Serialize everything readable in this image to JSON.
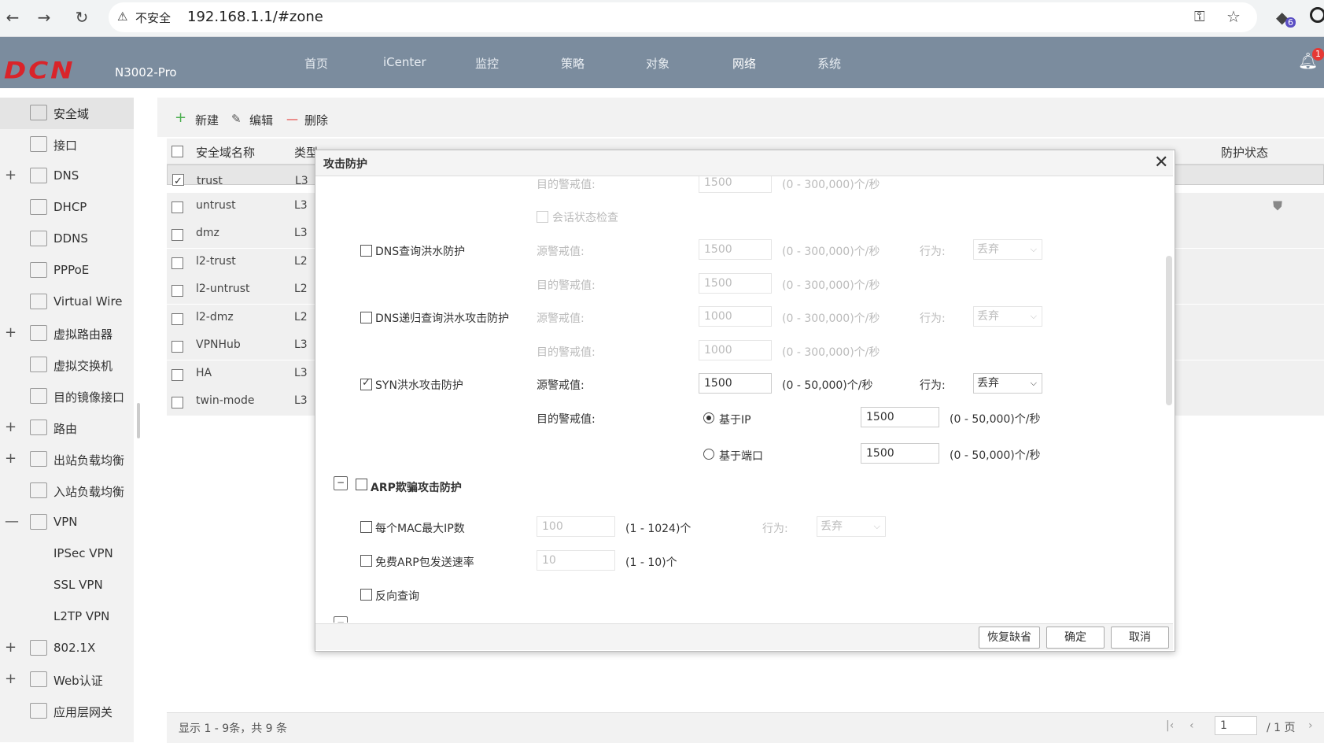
{
  "browser": {
    "back": "←",
    "forward": "→",
    "reload": "↻",
    "security": "不安全",
    "url": "192.168.1.1/#zone",
    "ext_badge": "6"
  },
  "app": {
    "logo": "DCN",
    "model": "N3002-Pro",
    "nav": [
      "首页",
      "iCenter",
      "监控",
      "策略",
      "对象",
      "网络",
      "系统"
    ],
    "notification_count": "1"
  },
  "sidebar": {
    "items": [
      {
        "label": "安全域",
        "icon": "zone-icon",
        "expand": ""
      },
      {
        "label": "接口",
        "icon": "interface-icon",
        "expand": ""
      },
      {
        "label": "DNS",
        "icon": "dns-icon",
        "expand": "+"
      },
      {
        "label": "DHCP",
        "icon": "dhcp-icon",
        "expand": ""
      },
      {
        "label": "DDNS",
        "icon": "ddns-icon",
        "expand": ""
      },
      {
        "label": "PPPoE",
        "icon": "pppoe-icon",
        "expand": ""
      },
      {
        "label": "Virtual Wire",
        "icon": "virtual-wire-icon",
        "expand": ""
      },
      {
        "label": "虚拟路由器",
        "icon": "virtual-router-icon",
        "expand": "+"
      },
      {
        "label": "虚拟交换机",
        "icon": "virtual-switch-icon",
        "expand": ""
      },
      {
        "label": "目的镜像接口",
        "icon": "mirror-icon",
        "expand": ""
      },
      {
        "label": "路由",
        "icon": "route-icon",
        "expand": "+"
      },
      {
        "label": "出站负载均衡",
        "icon": "outbound-lb-icon",
        "expand": "+"
      },
      {
        "label": "入站负载均衡",
        "icon": "inbound-lb-icon",
        "expand": ""
      },
      {
        "label": "VPN",
        "icon": "vpn-icon",
        "expand": "—"
      },
      {
        "label": "IPSec VPN",
        "icon": "",
        "expand": ""
      },
      {
        "label": "SSL VPN",
        "icon": "",
        "expand": ""
      },
      {
        "label": "L2TP VPN",
        "icon": "",
        "expand": ""
      },
      {
        "label": "802.1X",
        "icon": "8021x-icon",
        "expand": "+"
      },
      {
        "label": "Web认证",
        "icon": "web-auth-icon",
        "expand": "+"
      },
      {
        "label": "应用层网关",
        "icon": "alg-icon",
        "expand": ""
      }
    ]
  },
  "toolbar": {
    "new": "新建",
    "edit": "编辑",
    "delete": "删除"
  },
  "table": {
    "headers": [
      "安全域名称",
      "类型",
      "防护状态"
    ],
    "rows": [
      {
        "name": "trust",
        "type": "L3"
      },
      {
        "name": "untrust",
        "type": "L3"
      },
      {
        "name": "dmz",
        "type": "L3"
      },
      {
        "name": "l2-trust",
        "type": "L2"
      },
      {
        "name": "l2-untrust",
        "type": "L2"
      },
      {
        "name": "l2-dmz",
        "type": "L2"
      },
      {
        "name": "VPNHub",
        "type": "L3"
      },
      {
        "name": "HA",
        "type": "L3"
      },
      {
        "name": "twin-mode",
        "type": "L3"
      }
    ],
    "footer": "显示 1 - 9条，共 9 条",
    "page": "1",
    "page_total": "/ 1 页"
  },
  "dialog": {
    "title": "攻击防护",
    "close": "✕",
    "dst_threshold": "目的警戒值:",
    "src_threshold": "源警戒值:",
    "action": "行为:",
    "drop": "丢弃",
    "session_check": "会话状态检查",
    "dns_query_flood": "DNS查询洪水防护",
    "dns_recursive_flood": "DNS递归查询洪水攻击防护",
    "syn_flood": "SYN洪水攻击防护",
    "based_on_ip": "基于IP",
    "based_on_port": "基于端口",
    "arp_spoof": "ARP欺骗攻击防护",
    "max_ip_per_mac": "每个MAC最大IP数",
    "gratuitous_arp": "免费ARP包发送速率",
    "reverse_query": "反向查询",
    "range_300k": "(0 - 300,000)个/秒",
    "range_50k": "(0 - 50,000)个/秒",
    "range_1024": "(1 - 1024)个",
    "range_10": "(1 - 10)个",
    "v1500": "1500",
    "v1000": "1000",
    "v100": "100",
    "v10": "10",
    "btn_restore": "恢复缺省",
    "btn_ok": "确定",
    "btn_cancel": "取消"
  }
}
